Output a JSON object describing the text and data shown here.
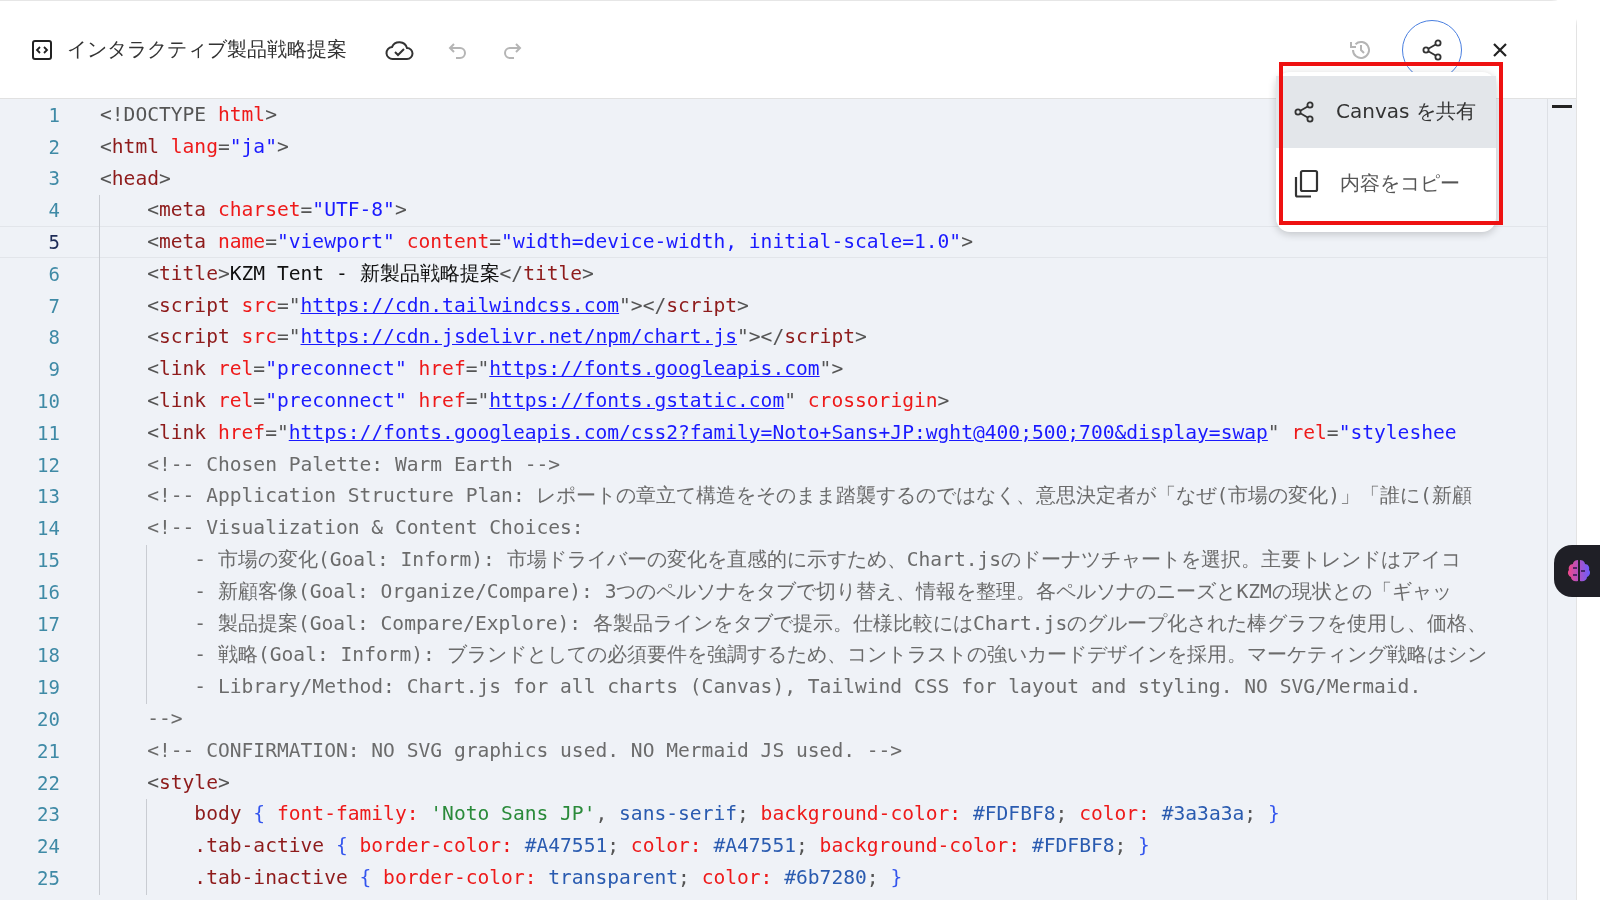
{
  "header": {
    "title": "インタラクティブ製品戦略提案",
    "undo": {
      "disabled": true
    },
    "redo": {
      "disabled": true
    },
    "history": {
      "disabled": true
    },
    "share": {
      "active": true
    },
    "menu": {
      "highlighted": true,
      "items": [
        {
          "kind": "share",
          "label": "Canvas を共有",
          "selected": true
        },
        {
          "kind": "copy",
          "label": "内容をコピー",
          "selected": false
        }
      ]
    }
  },
  "editor": {
    "lines": [
      {
        "number": "1",
        "selected": false,
        "tokens": [
          {
            "kind": "punct",
            "text": "<!DOCTYPE "
          },
          {
            "kind": "attr",
            "text": "html"
          },
          {
            "kind": "punct",
            "text": ">"
          }
        ]
      },
      {
        "number": "2",
        "selected": false,
        "tokens": [
          {
            "kind": "punct",
            "text": "<"
          },
          {
            "kind": "tag",
            "text": "html"
          },
          {
            "kind": "attr",
            "text": " lang"
          },
          {
            "kind": "punct",
            "text": "="
          },
          {
            "kind": "string",
            "text": "\"ja\""
          },
          {
            "kind": "punct",
            "text": ">"
          }
        ]
      },
      {
        "number": "3",
        "selected": false,
        "tokens": [
          {
            "kind": "punct",
            "text": "<"
          },
          {
            "kind": "tag",
            "text": "head"
          },
          {
            "kind": "punct",
            "text": ">"
          }
        ]
      },
      {
        "number": "4",
        "selected": false,
        "tokens": [
          {
            "kind": "punct",
            "text": "    <"
          },
          {
            "kind": "tag",
            "text": "meta"
          },
          {
            "kind": "attr",
            "text": " charset"
          },
          {
            "kind": "punct",
            "text": "="
          },
          {
            "kind": "string",
            "text": "\"UTF-8\""
          },
          {
            "kind": "punct",
            "text": ">"
          }
        ]
      },
      {
        "number": "5",
        "selected": true,
        "tokens": [
          {
            "kind": "punct",
            "text": "    <"
          },
          {
            "kind": "tag",
            "text": "meta"
          },
          {
            "kind": "attr",
            "text": " name"
          },
          {
            "kind": "punct",
            "text": "="
          },
          {
            "kind": "string",
            "text": "\"viewport\""
          },
          {
            "kind": "attr",
            "text": " content"
          },
          {
            "kind": "punct",
            "text": "="
          },
          {
            "kind": "string",
            "text": "\"width=device-width, initial-scale=1.0\""
          },
          {
            "kind": "punct",
            "text": ">"
          }
        ]
      },
      {
        "number": "6",
        "selected": false,
        "tokens": [
          {
            "kind": "punct",
            "text": "    <"
          },
          {
            "kind": "tag",
            "text": "title"
          },
          {
            "kind": "punct",
            "text": ">"
          },
          {
            "kind": "text",
            "text": "KZM Tent - 新製品戦略提案"
          },
          {
            "kind": "punct",
            "text": "</"
          },
          {
            "kind": "tag",
            "text": "title"
          },
          {
            "kind": "punct",
            "text": ">"
          }
        ]
      },
      {
        "number": "7",
        "selected": false,
        "tokens": [
          {
            "kind": "punct",
            "text": "    <"
          },
          {
            "kind": "tag",
            "text": "script"
          },
          {
            "kind": "attr",
            "text": " src"
          },
          {
            "kind": "punct",
            "text": "=\""
          },
          {
            "kind": "link",
            "text": "https://cdn.tailwindcss.com"
          },
          {
            "kind": "punct",
            "text": "\"></"
          },
          {
            "kind": "tag",
            "text": "script"
          },
          {
            "kind": "punct",
            "text": ">"
          }
        ]
      },
      {
        "number": "8",
        "selected": false,
        "tokens": [
          {
            "kind": "punct",
            "text": "    <"
          },
          {
            "kind": "tag",
            "text": "script"
          },
          {
            "kind": "attr",
            "text": " src"
          },
          {
            "kind": "punct",
            "text": "=\""
          },
          {
            "kind": "link",
            "text": "https://cdn.jsdelivr.net/npm/chart.js"
          },
          {
            "kind": "punct",
            "text": "\"></"
          },
          {
            "kind": "tag",
            "text": "script"
          },
          {
            "kind": "punct",
            "text": ">"
          }
        ]
      },
      {
        "number": "9",
        "selected": false,
        "tokens": [
          {
            "kind": "punct",
            "text": "    <"
          },
          {
            "kind": "tag",
            "text": "link"
          },
          {
            "kind": "attr",
            "text": " rel"
          },
          {
            "kind": "punct",
            "text": "="
          },
          {
            "kind": "string",
            "text": "\"preconnect\""
          },
          {
            "kind": "attr",
            "text": " href"
          },
          {
            "kind": "punct",
            "text": "=\""
          },
          {
            "kind": "link",
            "text": "https://fonts.googleapis.com"
          },
          {
            "kind": "punct",
            "text": "\">"
          }
        ]
      },
      {
        "number": "10",
        "selected": false,
        "tokens": [
          {
            "kind": "punct",
            "text": "    <"
          },
          {
            "kind": "tag",
            "text": "link"
          },
          {
            "kind": "attr",
            "text": " rel"
          },
          {
            "kind": "punct",
            "text": "="
          },
          {
            "kind": "string",
            "text": "\"preconnect\""
          },
          {
            "kind": "attr",
            "text": " href"
          },
          {
            "kind": "punct",
            "text": "=\""
          },
          {
            "kind": "link",
            "text": "https://fonts.gstatic.com"
          },
          {
            "kind": "punct",
            "text": "\""
          },
          {
            "kind": "attr",
            "text": " crossorigin"
          },
          {
            "kind": "punct",
            "text": ">"
          }
        ]
      },
      {
        "number": "11",
        "selected": false,
        "tokens": [
          {
            "kind": "punct",
            "text": "    <"
          },
          {
            "kind": "tag",
            "text": "link"
          },
          {
            "kind": "attr",
            "text": " href"
          },
          {
            "kind": "punct",
            "text": "=\""
          },
          {
            "kind": "link",
            "text": "https://fonts.googleapis.com/css2?family=Noto+Sans+JP:wght@400;500;700&display=swap"
          },
          {
            "kind": "punct",
            "text": "\""
          },
          {
            "kind": "attr",
            "text": " rel"
          },
          {
            "kind": "punct",
            "text": "="
          },
          {
            "kind": "string",
            "text": "\"styleshee"
          }
        ]
      },
      {
        "number": "12",
        "selected": false,
        "tokens": [
          {
            "kind": "comment",
            "text": "    <!-- Chosen Palette: Warm Earth -->"
          }
        ]
      },
      {
        "number": "13",
        "selected": false,
        "tokens": [
          {
            "kind": "comment",
            "text": "    <!-- Application Structure Plan: レポートの章立て構造をそのまま踏襲するのではなく、意思決定者が「なぜ(市場の変化)」「誰に(新顧"
          }
        ]
      },
      {
        "number": "14",
        "selected": false,
        "tokens": [
          {
            "kind": "comment",
            "text": "    <!-- Visualization & Content Choices:"
          }
        ]
      },
      {
        "number": "15",
        "selected": false,
        "tokens": [
          {
            "kind": "comment",
            "text": "        - 市場の変化(Goal: Inform): 市場ドライバーの変化を直感的に示すため、Chart.jsのドーナツチャートを選択。主要トレンドはアイコ"
          }
        ]
      },
      {
        "number": "16",
        "selected": false,
        "tokens": [
          {
            "kind": "comment",
            "text": "        - 新顧客像(Goal: Organize/Compare): 3つのペルソナをタブで切り替え、情報を整理。各ペルソナのニーズとKZMの現状との「ギャッ"
          }
        ]
      },
      {
        "number": "17",
        "selected": false,
        "tokens": [
          {
            "kind": "comment",
            "text": "        - 製品提案(Goal: Compare/Explore): 各製品ラインをタブで提示。仕様比較にはChart.jsのグループ化された棒グラフを使用し、価格、"
          }
        ]
      },
      {
        "number": "18",
        "selected": false,
        "tokens": [
          {
            "kind": "comment",
            "text": "        - 戦略(Goal: Inform): ブランドとしての必須要件を強調するため、コントラストの強いカードデザインを採用。マーケティング戦略はシン"
          }
        ]
      },
      {
        "number": "19",
        "selected": false,
        "tokens": [
          {
            "kind": "comment",
            "text": "        - Library/Method: Chart.js for all charts (Canvas), Tailwind CSS for layout and styling. NO SVG/Mermaid."
          }
        ]
      },
      {
        "number": "20",
        "selected": false,
        "tokens": [
          {
            "kind": "comment",
            "text": "    -->"
          }
        ]
      },
      {
        "number": "21",
        "selected": false,
        "tokens": [
          {
            "kind": "comment",
            "text": "    <!-- CONFIRMATION: NO SVG graphics used. NO Mermaid JS used. -->"
          }
        ]
      },
      {
        "number": "22",
        "selected": false,
        "tokens": [
          {
            "kind": "punct",
            "text": "    <"
          },
          {
            "kind": "tag",
            "text": "style"
          },
          {
            "kind": "punct",
            "text": ">"
          }
        ]
      },
      {
        "number": "23",
        "selected": false,
        "tokens": [
          {
            "kind": "selector",
            "text": "        body"
          },
          {
            "kind": "brace",
            "text": " {"
          },
          {
            "kind": "prop",
            "text": " font-family:"
          },
          {
            "kind": "cssstring",
            "text": " 'Noto Sans JP'"
          },
          {
            "kind": "punct",
            "text": ","
          },
          {
            "kind": "value",
            "text": " sans-serif"
          },
          {
            "kind": "punct",
            "text": ";"
          },
          {
            "kind": "prop",
            "text": " background-color:"
          },
          {
            "kind": "value",
            "text": " #FDFBF8"
          },
          {
            "kind": "punct",
            "text": ";"
          },
          {
            "kind": "prop",
            "text": " color:"
          },
          {
            "kind": "value",
            "text": " #3a3a3a"
          },
          {
            "kind": "punct",
            "text": ";"
          },
          {
            "kind": "brace",
            "text": " }"
          }
        ]
      },
      {
        "number": "24",
        "selected": false,
        "tokens": [
          {
            "kind": "selector",
            "text": "        .tab-active"
          },
          {
            "kind": "brace",
            "text": " {"
          },
          {
            "kind": "prop",
            "text": " border-color:"
          },
          {
            "kind": "value",
            "text": " #A47551"
          },
          {
            "kind": "punct",
            "text": ";"
          },
          {
            "kind": "prop",
            "text": " color:"
          },
          {
            "kind": "value",
            "text": " #A47551"
          },
          {
            "kind": "punct",
            "text": ";"
          },
          {
            "kind": "prop",
            "text": " background-color:"
          },
          {
            "kind": "value",
            "text": " #FDFBF8"
          },
          {
            "kind": "punct",
            "text": ";"
          },
          {
            "kind": "brace",
            "text": " }"
          }
        ]
      },
      {
        "number": "25",
        "selected": false,
        "tokens": [
          {
            "kind": "selector",
            "text": "        .tab-inactive"
          },
          {
            "kind": "brace",
            "text": " {"
          },
          {
            "kind": "prop",
            "text": " border-color:"
          },
          {
            "kind": "value",
            "text": " transparent"
          },
          {
            "kind": "punct",
            "text": ";"
          },
          {
            "kind": "prop",
            "text": " color:"
          },
          {
            "kind": "value",
            "text": " #6b7280"
          },
          {
            "kind": "punct",
            "text": ";"
          },
          {
            "kind": "brace",
            "text": " }"
          }
        ]
      }
    ]
  }
}
